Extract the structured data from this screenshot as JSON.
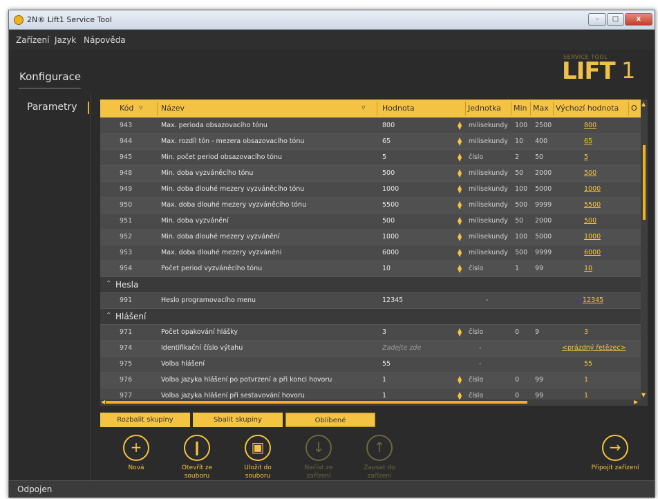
{
  "window": {
    "title": "2N® Lift1 Service Tool",
    "min_label": "–",
    "max_label": "□",
    "close_label": "x"
  },
  "menu": [
    "Zařízení",
    "Jazyk",
    "Nápověda"
  ],
  "header": {
    "page_title": "Konfigurace",
    "logo_small": "SERVICE TOOL",
    "logo_big": "LIFT",
    "logo_one": "1"
  },
  "sidebar": {
    "item": "Parametry"
  },
  "grid": {
    "columns": [
      "Kód",
      "Název",
      "Hodnota",
      "Jednotka",
      "Min",
      "Max",
      "Výchozí hodnota",
      "O"
    ],
    "rows_a": [
      {
        "code": "943",
        "name": "Max. perioda obsazovacího tónu",
        "value": "800",
        "unit": "milisekundy",
        "min": "100",
        "max": "2500",
        "default": "800"
      },
      {
        "code": "944",
        "name": "Max. rozdíl tón - mezera obsazovacího tónu",
        "value": "65",
        "unit": "milisekundy",
        "min": "10",
        "max": "400",
        "default": "65"
      },
      {
        "code": "945",
        "name": "Min. počet period obsazovacího tónu",
        "value": "5",
        "unit": "číslo",
        "min": "2",
        "max": "50",
        "default": "5"
      },
      {
        "code": "948",
        "name": "Min. doba vyzváněcího tónu",
        "value": "500",
        "unit": "milisekundy",
        "min": "50",
        "max": "2000",
        "default": "500"
      },
      {
        "code": "949",
        "name": "Min. doba dlouhé mezery vyzváněcího tónu",
        "value": "1000",
        "unit": "milisekundy",
        "min": "100",
        "max": "5000",
        "default": "1000"
      },
      {
        "code": "950",
        "name": "Max. doba dlouhé mezery vyzváněcího tónu",
        "value": "5500",
        "unit": "milisekundy",
        "min": "500",
        "max": "9999",
        "default": "5500"
      },
      {
        "code": "951",
        "name": "Min. doba vyzvánění",
        "value": "500",
        "unit": "milisekundy",
        "min": "50",
        "max": "2000",
        "default": "500"
      },
      {
        "code": "952",
        "name": "Min. doba dlouhé mezery vyzvánění",
        "value": "1000",
        "unit": "milisekundy",
        "min": "100",
        "max": "5000",
        "default": "1000"
      },
      {
        "code": "953",
        "name": "Max. doba dlouhé mezery vyzvánění",
        "value": "6000",
        "unit": "milisekundy",
        "min": "500",
        "max": "9999",
        "default": "6000"
      },
      {
        "code": "954",
        "name": "Počet period vyzváněcího tónu",
        "value": "10",
        "unit": "číslo",
        "min": "1",
        "max": "99",
        "default": "10"
      }
    ],
    "group_hesla": "Hesla",
    "row_hesla": {
      "code": "991",
      "name": "Heslo programovacího menu",
      "value": "12345",
      "unit": "-",
      "default": "12345"
    },
    "group_hlaseni": "Hlášení",
    "rows_b": [
      {
        "code": "971",
        "name": "Počet opakování hlášky",
        "value": "3",
        "unit": "číslo",
        "min": "0",
        "max": "9",
        "default": "3"
      },
      {
        "code": "974",
        "name": "Identifikační číslo výtahu",
        "value": "Zadejte zde",
        "unit": "-",
        "min": "",
        "max": "",
        "default": "<prázdný řetězec>"
      },
      {
        "code": "975",
        "name": "Volba hlášení",
        "value": "55",
        "unit": "-",
        "min": "",
        "max": "",
        "default": "55"
      },
      {
        "code": "976",
        "name": "Volba jazyka hlášení po potvrzení a při konci hovoru",
        "value": "1",
        "unit": "číslo",
        "min": "0",
        "max": "99",
        "default": "1"
      },
      {
        "code": "977",
        "name": "Volba jazyka hlášení při sestavování hovoru",
        "value": "1",
        "unit": "číslo",
        "min": "0",
        "max": "99",
        "default": "1"
      }
    ]
  },
  "tabs": [
    "Rozbalit skupiny",
    "Sbalit skupiny",
    "Oblíbené"
  ],
  "actions": [
    {
      "label1": "Nová",
      "label2": "",
      "glyph": "+"
    },
    {
      "label1": "Otevřít ze",
      "label2": "souboru",
      "glyph": "❙"
    },
    {
      "label1": "Uložit do",
      "label2": "souboru",
      "glyph": "▣"
    },
    {
      "label1": "Načíst ze",
      "label2": "zařízení",
      "glyph": "↓"
    },
    {
      "label1": "Zapsat do",
      "label2": "zařízení",
      "glyph": "↑"
    },
    {
      "label1": "Připojit zařízení",
      "label2": "",
      "glyph": "→"
    }
  ],
  "status": {
    "text": "Odpojen"
  },
  "colors": {
    "accent": "#f5c343",
    "background": "#2b2b2b",
    "grid_row": "#4a4a4a"
  }
}
